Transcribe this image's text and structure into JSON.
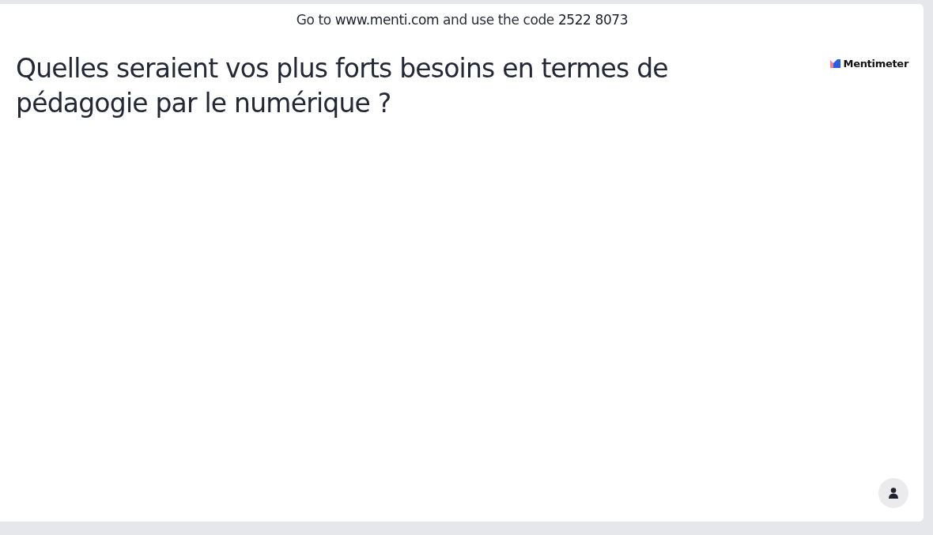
{
  "join_banner": "Go to **www.menti.com** and use the code **2522 8073**",
  "question": "Quelles seraient vos plus forts besoins en termes de pédagogie par le numérique ?",
  "logo": {
    "name": "Mentimeter"
  },
  "participants_button": {
    "kind": "person"
  }
}
